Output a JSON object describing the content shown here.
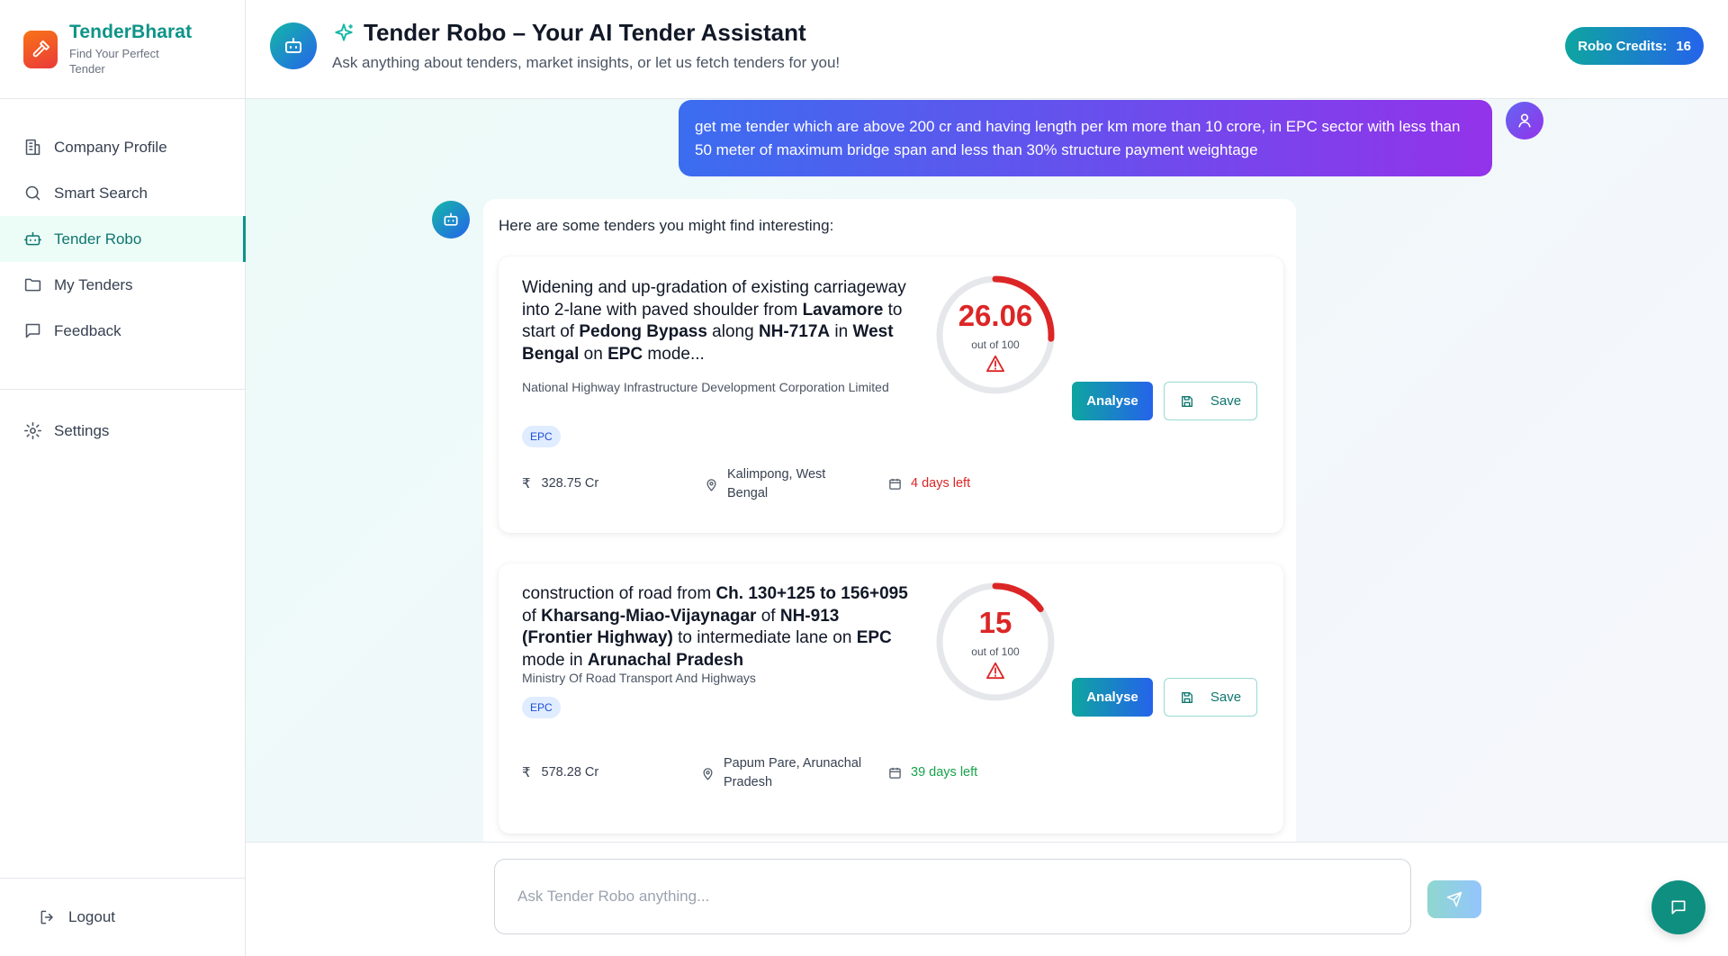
{
  "brand": {
    "name": "TenderBharat",
    "tagline": "Find Your Perfect Tender",
    "icon": "hammer-icon",
    "accent": "#0d9488"
  },
  "sidebar": {
    "items": [
      {
        "label": "Company Profile",
        "icon": "building-icon"
      },
      {
        "label": "Smart Search",
        "icon": "search-icon"
      },
      {
        "label": "Tender Robo",
        "icon": "robot-icon",
        "active": true
      },
      {
        "label": "My Tenders",
        "icon": "folder-icon"
      },
      {
        "label": "Feedback",
        "icon": "chat-icon"
      }
    ],
    "settings": {
      "label": "Settings",
      "icon": "gear-icon"
    },
    "logout": {
      "label": "Logout",
      "icon": "logout-icon"
    }
  },
  "header": {
    "title": "Tender Robo – Your AI Tender Assistant",
    "subtitle": "Ask anything about tenders, market insights, or let us fetch tenders for you!",
    "credits_label": "Robo Credits:",
    "credits_value": "16"
  },
  "chat": {
    "user_message": "get me tender which are above 200 cr and having length per km more than 10 crore, in EPC sector with less than 50 meter of maximum bridge span and less than 30% structure payment weightage",
    "bot_intro": "Here are some tenders you might find interesting:",
    "tenders": [
      {
        "title_parts": [
          {
            "t": "Widening and up-gradation of existing carriageway into 2-lane with paved shoulder from ",
            "b": false
          },
          {
            "t": "Lavamore",
            "b": true
          },
          {
            "t": " to start of ",
            "b": false
          },
          {
            "t": "Pedong Bypass",
            "b": true
          },
          {
            "t": " along ",
            "b": false
          },
          {
            "t": "NH-717A",
            "b": true
          },
          {
            "t": " in ",
            "b": false
          },
          {
            "t": "West Bengal",
            "b": true
          },
          {
            "t": " on ",
            "b": false
          },
          {
            "t": "EPC",
            "b": true
          },
          {
            "t": " mode...",
            "b": false
          }
        ],
        "organization": "National Highway Infrastructure Development Corporation Limited",
        "tag": "EPC",
        "score": "26.06",
        "score_fraction": 0.2606,
        "score_label": "out of 100",
        "value": "328.75 Cr",
        "location": "Kalimpong, West Bengal",
        "deadline": "4 days left",
        "deadline_status": "urgent",
        "analyse_label": "Analyse",
        "save_label": "Save"
      },
      {
        "title_parts": [
          {
            "t": "construction of road from ",
            "b": false
          },
          {
            "t": "Ch. 130+125 to 156+095",
            "b": true
          },
          {
            "t": " of ",
            "b": false
          },
          {
            "t": "Kharsang-Miao-Vijaynagar",
            "b": true
          },
          {
            "t": " of ",
            "b": false
          },
          {
            "t": "NH-913 (Frontier Highway)",
            "b": true
          },
          {
            "t": " to intermediate lane on ",
            "b": false
          },
          {
            "t": "EPC",
            "b": true
          },
          {
            "t": " mode in ",
            "b": false
          },
          {
            "t": "Arunachal Pradesh",
            "b": true
          }
        ],
        "organization": "Ministry Of Road Transport And Highways",
        "tag": "EPC",
        "score": "15",
        "score_fraction": 0.15,
        "score_label": "out of 100",
        "value": "578.28 Cr",
        "location": "Papum Pare, Arunachal Pradesh",
        "deadline": "39 days left",
        "deadline_status": "ok",
        "analyse_label": "Analyse",
        "save_label": "Save"
      }
    ]
  },
  "composer": {
    "placeholder": "Ask Tender Robo anything...",
    "value": ""
  },
  "colors": {
    "score_red": "#dc2626",
    "deadline_green": "#16a34a",
    "gauge_track": "#e5e7eb"
  }
}
